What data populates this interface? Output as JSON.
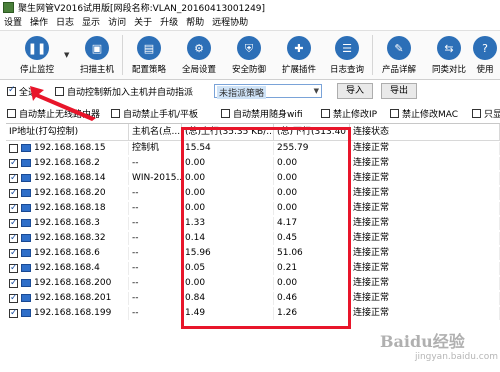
{
  "window": {
    "title": "聚生网管V2016试用版[网段名称:VLAN_20160413001249]"
  },
  "menu": [
    "设置",
    "操作",
    "日志",
    "显示",
    "访问",
    "关于",
    "升级",
    "帮助",
    "远程协助"
  ],
  "toolbar": {
    "buttons": [
      {
        "label": "停止监控",
        "icon": "pause-icon"
      },
      {
        "label": "扫描主机",
        "icon": "computer-scan-icon"
      },
      {
        "label": "配置策略",
        "icon": "policy-icon"
      },
      {
        "label": "全局设置",
        "icon": "settings-icon"
      },
      {
        "label": "安全防御",
        "icon": "shield-icon"
      },
      {
        "label": "扩展插件",
        "icon": "plugin-icon"
      },
      {
        "label": "日志查询",
        "icon": "log-icon"
      },
      {
        "label": "产品详解",
        "icon": "book-icon"
      },
      {
        "label": "同类对比",
        "icon": "compare-icon"
      },
      {
        "label": "使用",
        "icon": "help-icon"
      }
    ]
  },
  "filters": {
    "select_all": {
      "label": "全选",
      "checked": true
    },
    "auto_control_new": {
      "label": "自动控制新加入主机并自动指派",
      "checked": false
    },
    "policy_combo": {
      "value": "未指派策略"
    },
    "import_label": "导入",
    "export_label": "导出",
    "row2": [
      {
        "label": "自动禁止无线路由器",
        "checked": false
      },
      {
        "label": "自动禁止手机/平板",
        "checked": false
      },
      {
        "label": "自动禁用随身wifi",
        "checked": false
      },
      {
        "label": "禁止修改IP",
        "checked": false
      },
      {
        "label": "禁止修改MAC",
        "checked": false
      },
      {
        "label": "只显",
        "checked": false
      }
    ]
  },
  "table": {
    "columns": [
      "IP地址(打勾控制)",
      "主机名(点...",
      "(总)上行(35.35 KB/...",
      "(总)下行(313.40 K...",
      "连接状态"
    ],
    "rows": [
      {
        "ip": "192.168.168.15",
        "host": "控制机",
        "up": "15.54",
        "down": "255.79",
        "status": "连接正常",
        "checked": false
      },
      {
        "ip": "192.168.168.2",
        "host": "--",
        "up": "0.00",
        "down": "0.00",
        "status": "连接正常",
        "checked": true
      },
      {
        "ip": "192.168.168.14",
        "host": "WIN-2015...",
        "up": "0.00",
        "down": "0.00",
        "status": "连接正常",
        "checked": true
      },
      {
        "ip": "192.168.168.20",
        "host": "--",
        "up": "0.00",
        "down": "0.00",
        "status": "连接正常",
        "checked": true
      },
      {
        "ip": "192.168.168.18",
        "host": "--",
        "up": "0.00",
        "down": "0.00",
        "status": "连接正常",
        "checked": true
      },
      {
        "ip": "192.168.168.3",
        "host": "--",
        "up": "1.33",
        "down": "4.17",
        "status": "连接正常",
        "checked": true
      },
      {
        "ip": "192.168.168.32",
        "host": "--",
        "up": "0.14",
        "down": "0.45",
        "status": "连接正常",
        "checked": true
      },
      {
        "ip": "192.168.168.6",
        "host": "--",
        "up": "15.96",
        "down": "51.06",
        "status": "连接正常",
        "checked": true
      },
      {
        "ip": "192.168.168.4",
        "host": "--",
        "up": "0.05",
        "down": "0.21",
        "status": "连接正常",
        "checked": true
      },
      {
        "ip": "192.168.168.200",
        "host": "--",
        "up": "0.00",
        "down": "0.00",
        "status": "连接正常",
        "checked": true
      },
      {
        "ip": "192.168.168.201",
        "host": "--",
        "up": "0.84",
        "down": "0.46",
        "status": "连接正常",
        "checked": true
      },
      {
        "ip": "192.168.168.199",
        "host": "--",
        "up": "1.49",
        "down": "1.26",
        "status": "连接正常",
        "checked": true
      }
    ]
  },
  "watermark": {
    "title": "Baidu经验",
    "sub": "jingyan.baidu.com"
  },
  "colors": {
    "accent": "#2c6fb7",
    "annotation": "#e8152a"
  }
}
